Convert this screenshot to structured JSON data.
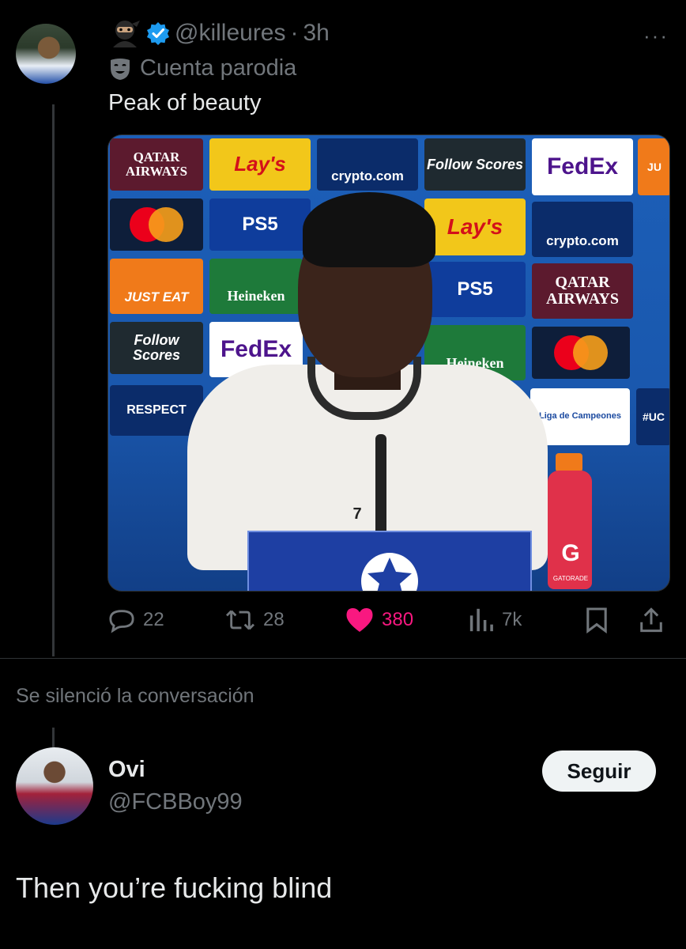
{
  "tweet": {
    "username": "@killeures",
    "time_sep": "·",
    "time": "3h",
    "more": "···",
    "parody_label": "Cuenta parodia",
    "text": "Peak of beauty",
    "media": {
      "boards": [
        {
          "text": "QATAR AIRWAYS"
        },
        {
          "text": "Lay's"
        },
        {
          "text": "crypto.com"
        },
        {
          "text": "Follow Scores"
        },
        {
          "text": "FedEx"
        },
        {
          "text": "JU"
        },
        {
          "text": "PS5"
        },
        {
          "text": "Lay's"
        },
        {
          "text": "crypto.com"
        },
        {
          "text": "JUST EAT"
        },
        {
          "text": "Heineken"
        },
        {
          "text": "PS5"
        },
        {
          "text": "QATAR AIRWAYS"
        },
        {
          "text": "Follow Scores"
        },
        {
          "text": "FedEx"
        },
        {
          "text": "Heineken"
        },
        {
          "text": "RESPECT"
        },
        {
          "text": "Liga de Campeones"
        },
        {
          "text": "#UC"
        },
        {
          "text": "7"
        },
        {
          "text": "G"
        },
        {
          "text": "GATORADE"
        }
      ]
    },
    "stats": {
      "replies": "22",
      "retweets": "28",
      "likes": "380",
      "views": "7k"
    }
  },
  "muted_notice": "Se silenció la conversación",
  "reply": {
    "name": "Ovi",
    "handle": "@FCBBoy99",
    "follow_label": "Seguir",
    "text": "Then you’re fucking blind"
  },
  "colors": {
    "background": "#000000",
    "muted_text": "#71767b",
    "like_pink": "#f91880",
    "verified_blue": "#1d9bf0"
  }
}
